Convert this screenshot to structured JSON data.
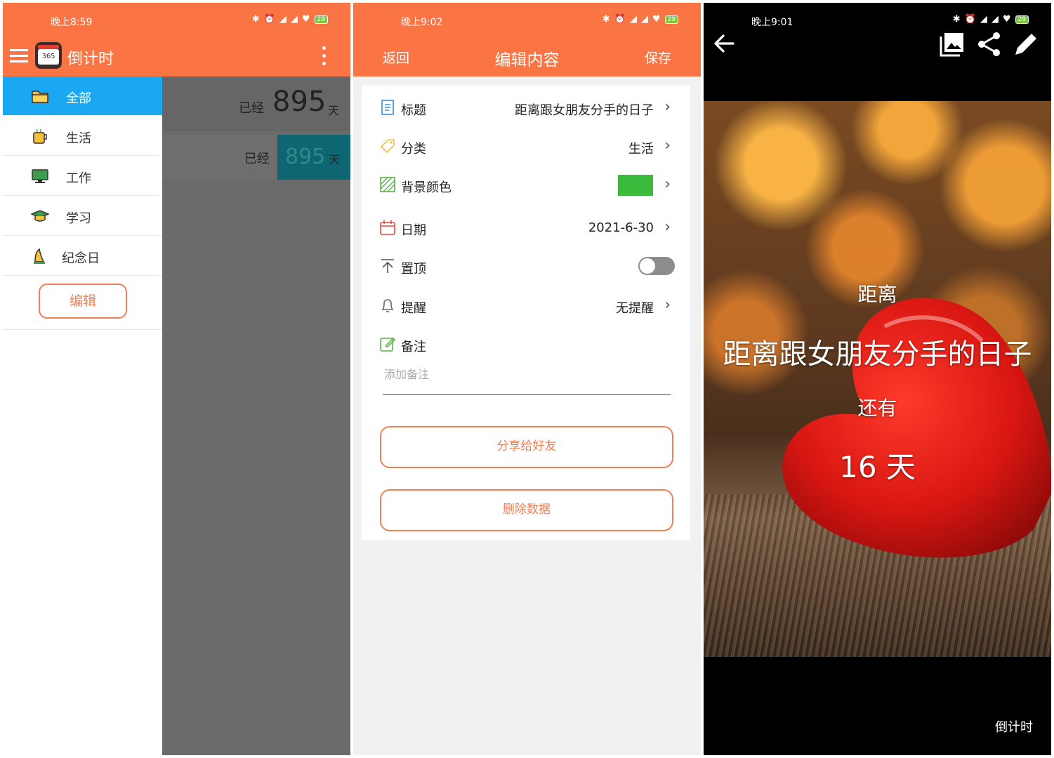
{
  "phone1": {
    "status": {
      "time": "晚上8:59",
      "battery": "29"
    },
    "header": {
      "title": "倒计时",
      "logo_text": "365"
    },
    "drawer": {
      "items": [
        {
          "label": "全部",
          "icon": "folder-icon",
          "active": true
        },
        {
          "label": "生活",
          "icon": "cup-icon",
          "active": false
        },
        {
          "label": "工作",
          "icon": "monitor-icon",
          "active": false
        },
        {
          "label": "学习",
          "icon": "graduation-cap-icon",
          "active": false
        },
        {
          "label": "纪念日",
          "icon": "bell-icon",
          "active": false
        }
      ],
      "edit_label": "编辑"
    },
    "cards": [
      {
        "prefix": "已经",
        "count": "895",
        "unit": "天"
      },
      {
        "prefix": "已经",
        "count": "895",
        "unit": "天"
      }
    ]
  },
  "phone2": {
    "status": {
      "time": "晚上9:02",
      "battery": "29"
    },
    "header": {
      "back": "返回",
      "title": "编辑内容",
      "save": "保存"
    },
    "rows": {
      "title": {
        "label": "标题",
        "value": "距离跟女朋友分手的日子"
      },
      "category": {
        "label": "分类",
        "value": "生活"
      },
      "bg_color": {
        "label": "背景颜色",
        "color": "#3cba3c"
      },
      "date": {
        "label": "日期",
        "value": "2021-6-30"
      },
      "pin": {
        "label": "置顶",
        "on": false
      },
      "reminder": {
        "label": "提醒",
        "value": "无提醒"
      },
      "note": {
        "label": "备注",
        "placeholder": "添加备注"
      }
    },
    "buttons": {
      "share": "分享给好友",
      "delete": "删除数据"
    }
  },
  "phone3": {
    "status": {
      "time": "晚上9:01",
      "battery": "29"
    },
    "distance_label": "距离",
    "event_title": "距离跟女朋友分手的日子",
    "remaining_label": "还有",
    "days_value": "16 天",
    "brand": "倒计时"
  },
  "colors": {
    "accent": "#fb7443",
    "active_blue": "#1aa8f2",
    "button_orange": "#f08055"
  }
}
